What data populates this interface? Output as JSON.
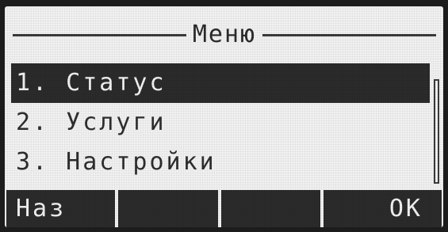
{
  "screen": {
    "title": "Меню"
  },
  "menu": {
    "items": [
      {
        "label": "1. Статус",
        "selected": true
      },
      {
        "label": "2. Услуги",
        "selected": false
      },
      {
        "label": "3. Настройки",
        "selected": false
      }
    ]
  },
  "softkeys": {
    "key1": "Наз",
    "key2": "",
    "key3": "",
    "key4": "OK"
  },
  "colors": {
    "lcd_background": "#f1f1f1",
    "lcd_foreground": "#2b2b2b",
    "bezel": "#1c1c1c"
  }
}
